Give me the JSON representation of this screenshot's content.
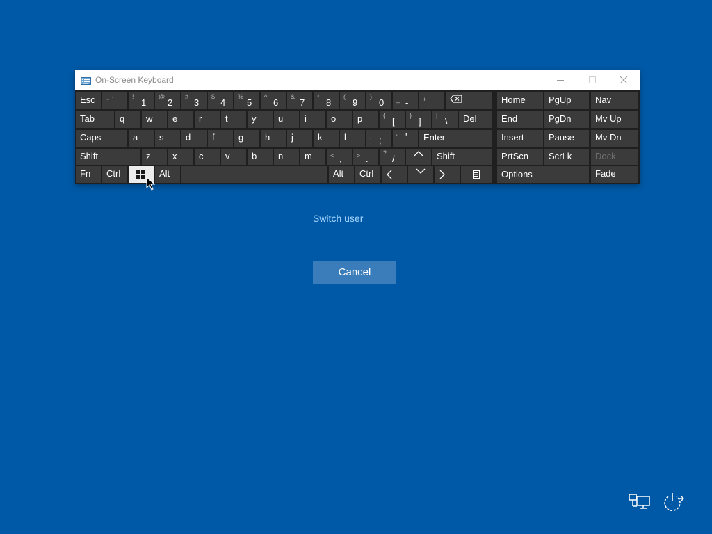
{
  "osk": {
    "title": "On-Screen Keyboard",
    "keys": {
      "esc": "Esc",
      "tilde": {
        "sub": "~ `",
        "main": ""
      },
      "d1": {
        "sub": "!",
        "main": "1"
      },
      "d2": {
        "sub": "@",
        "main": "2"
      },
      "d3": {
        "sub": "#",
        "main": "3"
      },
      "d4": {
        "sub": "$",
        "main": "4"
      },
      "d5": {
        "sub": "%",
        "main": "5"
      },
      "d6": {
        "sub": "^",
        "main": "6"
      },
      "d7": {
        "sub": "&",
        "main": "7"
      },
      "d8": {
        "sub": "*",
        "main": "8"
      },
      "d9": {
        "sub": "(",
        "main": "9"
      },
      "d0": {
        "sub": ")",
        "main": "0"
      },
      "minus": {
        "sub": "_",
        "main": "-"
      },
      "equals": {
        "sub": "+",
        "main": "="
      },
      "home": "Home",
      "pgup": "PgUp",
      "nav": "Nav",
      "tab": "Tab",
      "q": "q",
      "w": "w",
      "e": "e",
      "r": "r",
      "t": "t",
      "y": "y",
      "u": "u",
      "i": "i",
      "o": "o",
      "p": "p",
      "lbracket": {
        "sub": "{",
        "main": "["
      },
      "rbracket": {
        "sub": "}",
        "main": "]"
      },
      "backslash": {
        "sub": "|",
        "main": "\\"
      },
      "del": "Del",
      "end": "End",
      "pgdn": "PgDn",
      "mvup": "Mv Up",
      "caps": "Caps",
      "a": "a",
      "s": "s",
      "d": "d",
      "f": "f",
      "g": "g",
      "h": "h",
      "j": "j",
      "k": "k",
      "l": "l",
      "semicolon": {
        "sub": ":",
        "main": ";"
      },
      "quote": {
        "sub": "\"",
        "main": "'"
      },
      "enter": "Enter",
      "insert": "Insert",
      "pause": "Pause",
      "mvdn": "Mv Dn",
      "lshift": "Shift",
      "z": "z",
      "x": "x",
      "c": "c",
      "v": "v",
      "b": "b",
      "n": "n",
      "m": "m",
      "comma": {
        "sub": "<",
        "main": ","
      },
      "period": {
        "sub": ">",
        "main": "."
      },
      "slash": {
        "sub": "?",
        "main": "/"
      },
      "rshift": "Shift",
      "prtscn": "PrtScn",
      "scrlk": "ScrLk",
      "dock": "Dock",
      "fn": "Fn",
      "lctrl": "Ctrl",
      "lalt": "Alt",
      "ralt": "Alt",
      "rctrl": "Ctrl",
      "options": "Options",
      "fade": "Fade"
    },
    "icons": {
      "app": "keyboard-icon",
      "minimize": "minimize-icon",
      "maximize": "maximize-icon",
      "close": "close-icon",
      "backspace": "backspace-icon",
      "windows": "windows-logo-icon",
      "up": "arrow-up-icon",
      "down": "arrow-down-icon",
      "left": "arrow-left-icon",
      "right": "arrow-right-icon",
      "menu": "context-menu-icon"
    }
  },
  "login": {
    "switch_user": "Switch user",
    "cancel": "Cancel"
  },
  "corner_icons": [
    "network-icon",
    "power-icon"
  ],
  "colors": {
    "background": "#0059a6",
    "key": "#3b3b3b",
    "keyboard_bg": "#1f1f1f",
    "pressed_key": "#ececec",
    "link": "#a4d6ff",
    "button": "#3a7dba"
  }
}
